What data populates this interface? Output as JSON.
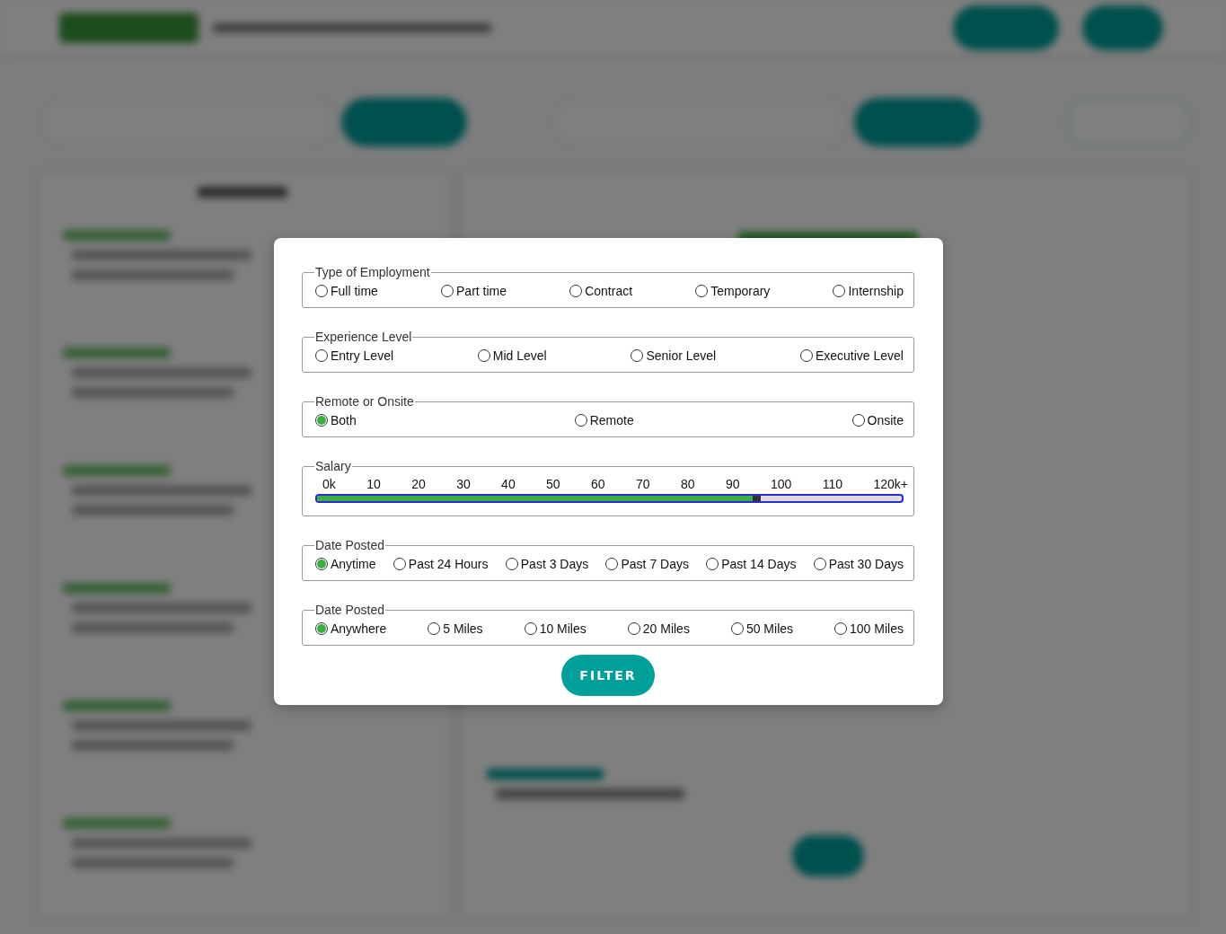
{
  "filter_dialog": {
    "groups": [
      {
        "kind": "radio",
        "legend": "Type of Employment",
        "options": [
          {
            "label": "Full time",
            "selected": false
          },
          {
            "label": "Part time",
            "selected": false
          },
          {
            "label": "Contract",
            "selected": false
          },
          {
            "label": "Temporary",
            "selected": false
          },
          {
            "label": "Internship",
            "selected": false
          }
        ]
      },
      {
        "kind": "radio",
        "legend": "Experience Level",
        "options": [
          {
            "label": "Entry Level",
            "selected": false
          },
          {
            "label": "Mid Level",
            "selected": false
          },
          {
            "label": "Senior Level",
            "selected": false
          },
          {
            "label": "Executive Level",
            "selected": false
          }
        ]
      },
      {
        "kind": "radio",
        "legend": "Remote or Onsite",
        "options": [
          {
            "label": "Both",
            "selected": true
          },
          {
            "label": "Remote",
            "selected": false
          },
          {
            "label": "Onsite",
            "selected": false
          }
        ]
      },
      {
        "kind": "slider",
        "legend": "Salary",
        "ticks": [
          "0k",
          "10",
          "20",
          "30",
          "40",
          "50",
          "60",
          "70",
          "80",
          "90",
          "100",
          "110",
          "120k+"
        ],
        "level": 0.745
      },
      {
        "kind": "radio",
        "legend": "Date Posted",
        "options": [
          {
            "label": "Anytime",
            "selected": true
          },
          {
            "label": "Past 24 Hours",
            "selected": false
          },
          {
            "label": "Past 3 Days",
            "selected": false
          },
          {
            "label": "Past 7 Days",
            "selected": false
          },
          {
            "label": "Past 14 Days",
            "selected": false
          },
          {
            "label": "Past 30 Days",
            "selected": false
          }
        ]
      },
      {
        "kind": "radio",
        "legend": "Date Posted",
        "options": [
          {
            "label": "Anywhere",
            "selected": true
          },
          {
            "label": "5 Miles",
            "selected": false
          },
          {
            "label": "10 Miles",
            "selected": false
          },
          {
            "label": "20 Miles",
            "selected": false
          },
          {
            "label": "50 Miles",
            "selected": false
          },
          {
            "label": "100 Miles",
            "selected": false
          }
        ]
      }
    ],
    "button": "FILTER"
  }
}
